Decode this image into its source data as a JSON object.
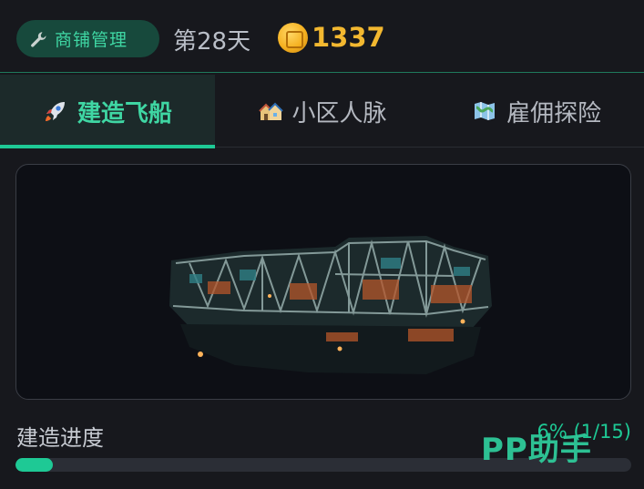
{
  "header": {
    "shop_button_label": "商铺管理",
    "day_label": "第28天",
    "coins": "1337"
  },
  "tabs": [
    {
      "label": "建造飞船",
      "icon": "rocket-icon",
      "active": true
    },
    {
      "label": "小区人脉",
      "icon": "houses-icon",
      "active": false
    },
    {
      "label": "雇佣探险",
      "icon": "map-icon",
      "active": false
    }
  ],
  "build": {
    "progress_label": "建造进度",
    "progress_text": "6% (1/15)",
    "progress_fraction": 0.06
  },
  "watermark": "PP助手",
  "colors": {
    "accent": "#1ec995",
    "coin": "#f3b830",
    "background": "#17181d"
  }
}
